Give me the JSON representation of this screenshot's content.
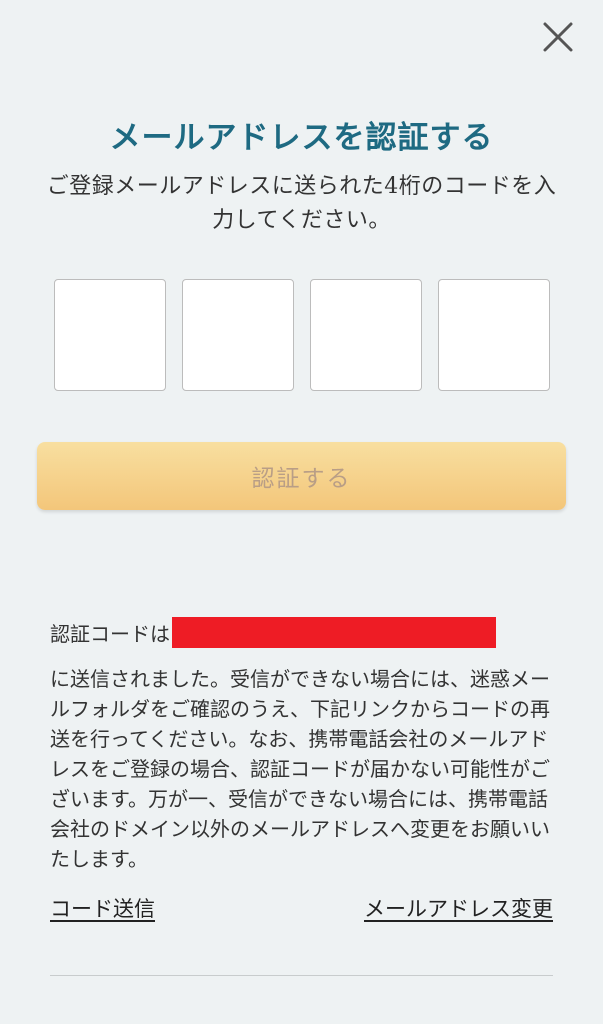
{
  "header": {
    "close_icon": "close-icon"
  },
  "title": "メールアドレスを認証する",
  "subtitle": "ご登録メールアドレスに送られた4桁のコードを入力してください。",
  "code_inputs": [
    {
      "value": ""
    },
    {
      "value": ""
    },
    {
      "value": ""
    },
    {
      "value": ""
    }
  ],
  "submit_label": "認証する",
  "sent_prefix": "認証コードは",
  "notice": "に送信されました。受信ができない場合には、迷惑メールフォルダをご確認のうえ、下記リンクからコードの再送を行ってください。なお、携帯電話会社のメールアドレスをご登録の場合、認証コードが届かない可能性がございます。万が一、受信ができない場合には、携帯電話会社のドメイン以外のメールアドレスへ変更をお願いいたします。",
  "links": {
    "resend": "コード送信",
    "change_email": "メールアドレス変更"
  },
  "colors": {
    "title": "#1e6a82",
    "background": "#eef2f3",
    "button_top": "#f8dfa0",
    "button_bottom": "#f3c67a",
    "button_text": "#b99e86",
    "redaction": "#ee1c25"
  }
}
